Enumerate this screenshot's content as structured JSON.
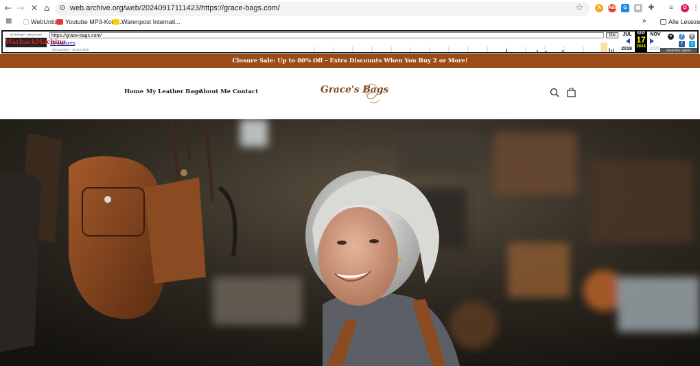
{
  "browser": {
    "url": "web.archive.org/web/20240917111423/https://grace-bags.com/",
    "bookmarks": [
      "WebUntis",
      "Youtube MP3-Konv...",
      "Warenpost Internati..."
    ],
    "all_bookmarks": "Alle Lesezeichen",
    "more": "»"
  },
  "wayback": {
    "logo_top": "INTERNET ARCHIVE",
    "logo_main": "WaybackMachine",
    "url_value": "https://grace-bags.com/",
    "go_label": "Go",
    "captures": "30 captures",
    "range": "26 Aug 2013 - 20 Apr 2025",
    "prev_month": "JUL",
    "prev_year": "2019",
    "cur_month": "SEP",
    "cur_day": "17",
    "cur_year": "2024",
    "next_month": "NOV",
    "next_year": "2025",
    "about": "About this capture"
  },
  "site": {
    "announcement": "Closure Sale: Up to 80% Off – Extra Discounts When You Buy 2 or More!",
    "nav": [
      "Home",
      "My Leather Bags",
      "About Me",
      "Contact"
    ],
    "logo": "Grace's Bags"
  },
  "colors": {
    "announcement_bg": "#9c4c18",
    "logo": "#7a4a1c",
    "wayback_today": "#ffff00"
  }
}
